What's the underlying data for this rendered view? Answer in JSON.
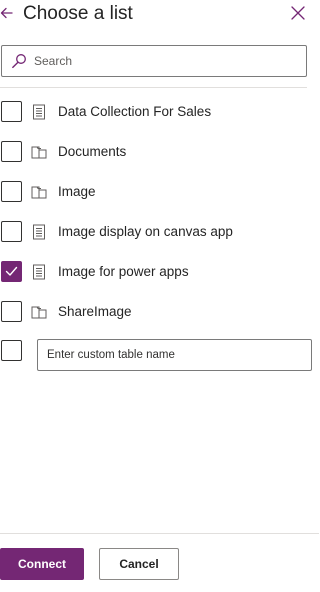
{
  "header": {
    "title": "Choose a list",
    "back_icon": "back-arrow-icon",
    "close_icon": "close-icon"
  },
  "search": {
    "placeholder": "Search",
    "value": "",
    "icon": "search-icon"
  },
  "colors": {
    "accent": "#742774",
    "border": "#7a7a7a",
    "divider": "#e1dfdd",
    "text": "#242424"
  },
  "lists": [
    {
      "label": "Data Collection For Sales",
      "icon": "list-icon",
      "checked": false
    },
    {
      "label": "Documents",
      "icon": "library-icon",
      "checked": false
    },
    {
      "label": "Image",
      "icon": "library-icon",
      "checked": false
    },
    {
      "label": "Image display on canvas app",
      "icon": "list-icon",
      "checked": false
    },
    {
      "label": "Image for power apps",
      "icon": "list-icon",
      "checked": true
    },
    {
      "label": "ShareImage",
      "icon": "library-icon",
      "checked": false
    }
  ],
  "custom_table": {
    "placeholder": "Enter custom table name",
    "value": "",
    "checked": false
  },
  "footer": {
    "connect_label": "Connect",
    "cancel_label": "Cancel"
  }
}
